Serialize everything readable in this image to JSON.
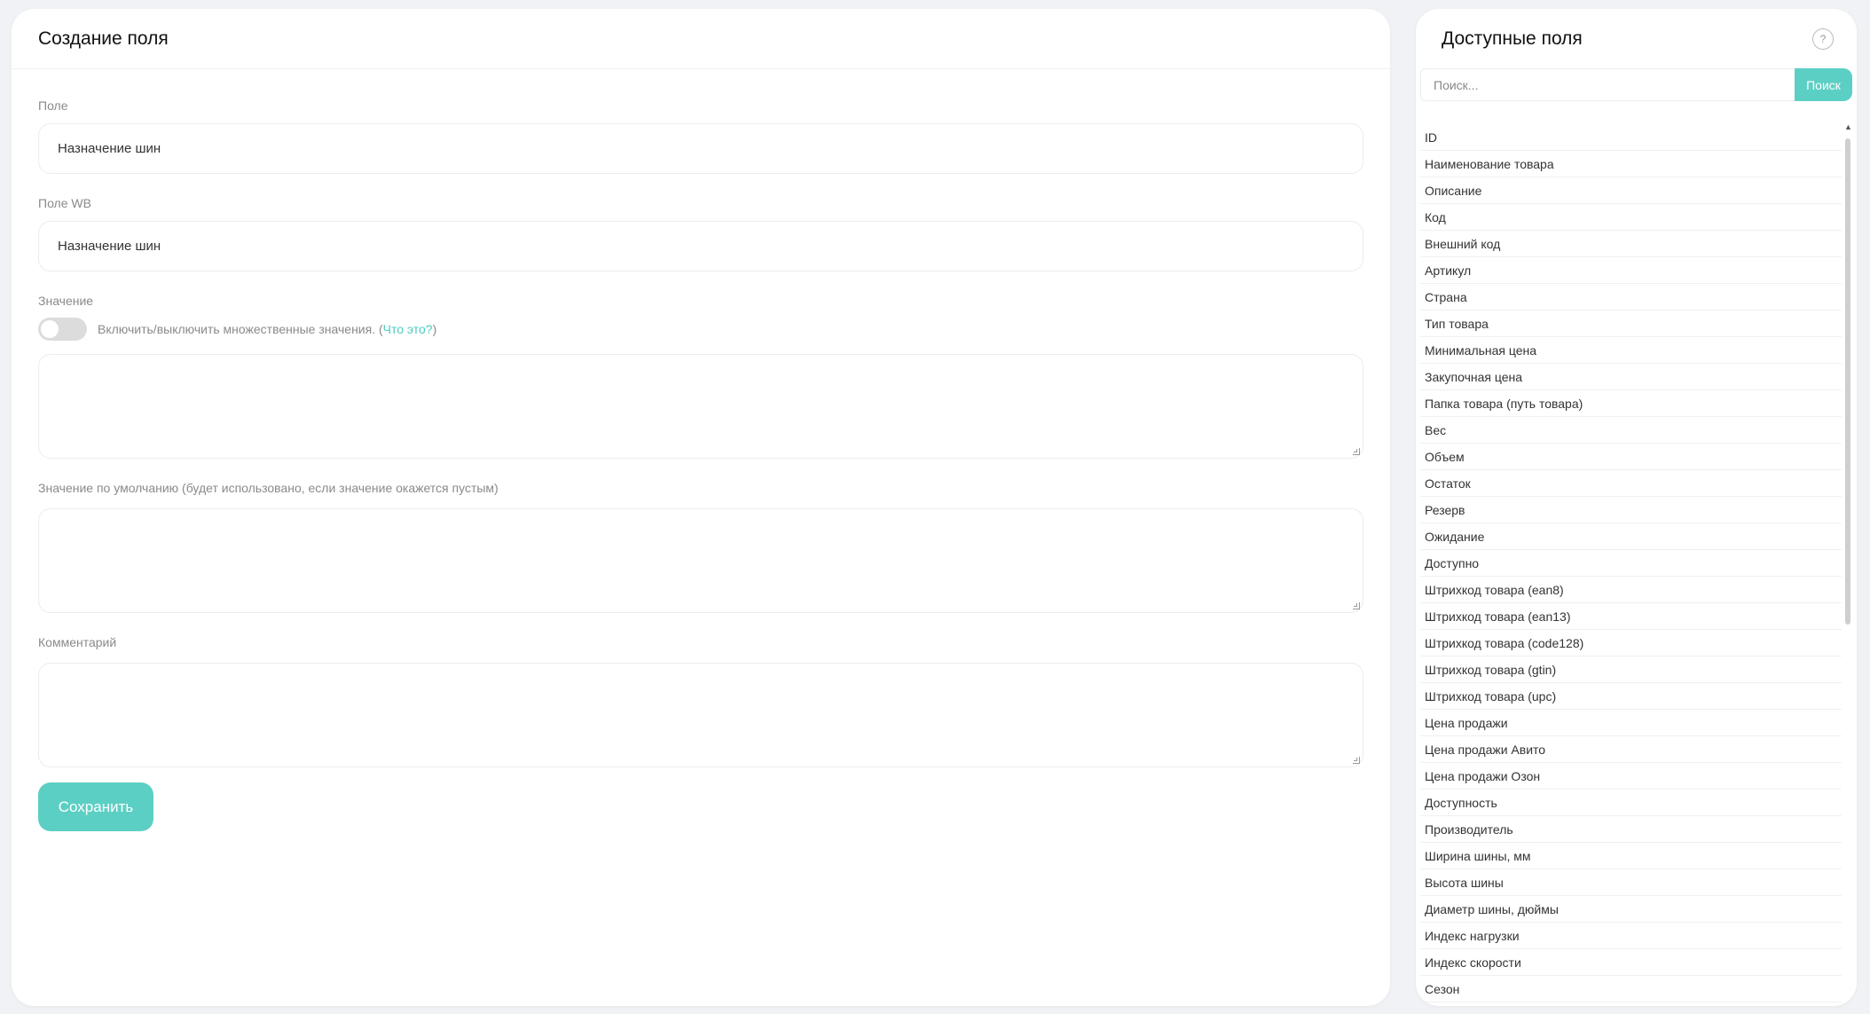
{
  "form": {
    "title": "Создание поля",
    "field_label": "Поле",
    "field_value": "Назначение шин",
    "wb_label": "Поле WB",
    "wb_value": "Назначение шин",
    "value_label": "Значение",
    "toggle_text": "Включить/выключить множественные значения. (",
    "toggle_link": "Что это?",
    "toggle_text_end": ")",
    "toggle_on": false,
    "default_label": "Значение по умолчанию (будет использовано, если значение окажется пустым)",
    "comment_label": "Комментарий",
    "save_label": "Сохранить"
  },
  "panel": {
    "title": "Доступные поля",
    "help": "?",
    "search_placeholder": "Поиск...",
    "search_button": "Поиск",
    "items": [
      "ID",
      "Наименование товара",
      "Описание",
      "Код",
      "Внешний код",
      "Артикул",
      "Страна",
      "Тип товара",
      "Минимальная цена",
      "Закупочная цена",
      "Папка товара (путь товара)",
      "Вес",
      "Объем",
      "Остаток",
      "Резерв",
      "Ожидание",
      "Доступно",
      "Штрихкод товара (ean8)",
      "Штрихкод товара (ean13)",
      "Штрихкод товара (code128)",
      "Штрихкод товара (gtin)",
      "Штрихкод товара (upc)",
      "Цена продажи",
      "Цена продажи Авито",
      "Цена продажи Озон",
      "Доступность",
      "Производитель",
      "Ширина шины, мм",
      "Высота шины",
      "Диаметр шины, дюймы",
      "Индекс нагрузки",
      "Индекс скорости",
      "Сезон"
    ]
  },
  "colors": {
    "accent": "#5ccfc4",
    "link": "#4fcbbf",
    "background": "#f0f2f5"
  }
}
